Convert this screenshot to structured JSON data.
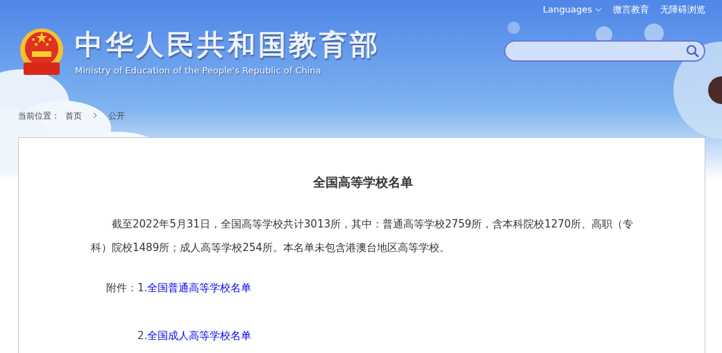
{
  "top_links": {
    "languages": "Languages",
    "links": [
      "微言教育",
      "无障碍浏览"
    ]
  },
  "header": {
    "title": "中华人民共和国教育部",
    "subtitle": "Ministry of Education of the People's Republic of China"
  },
  "breadcrumb": {
    "label": "当前位置：",
    "items": [
      "首页",
      "公开"
    ]
  },
  "article": {
    "title": "全国高等学校名单",
    "paragraph": "截至2022年5月31日，全国高等学校共计3013所，其中：普通高等学校2759所，含本科院校1270所、高职（专科）院校1489所；成人高等学校254所。本名单未包含港澳台地区高等学校。",
    "attachment_label": "附件：",
    "attachments": [
      {
        "number": "1.",
        "label": "全国普通高等学校名单"
      },
      {
        "number": "2.",
        "label": "全国成人高等学校名单"
      }
    ]
  }
}
